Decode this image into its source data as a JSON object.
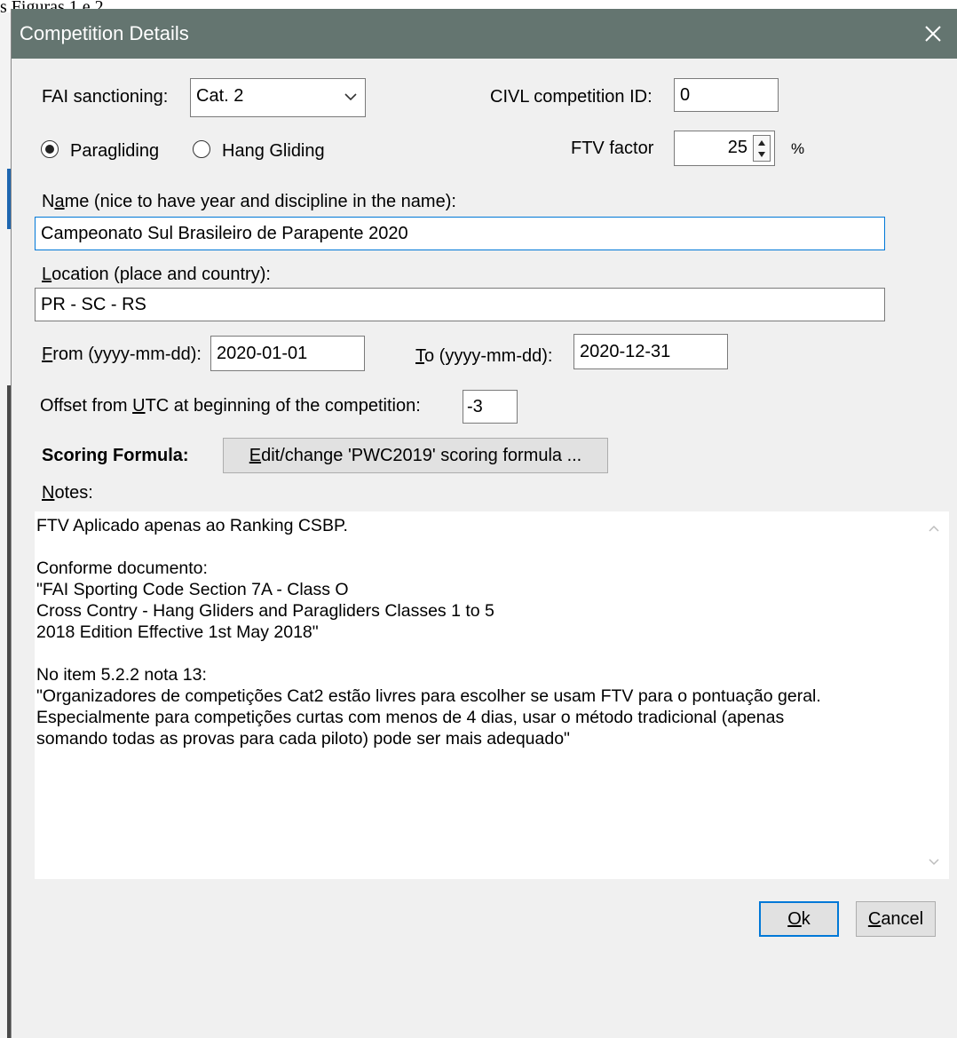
{
  "background": {
    "doc_text": "s Figuras 1 e 2."
  },
  "window": {
    "title": "Competition Details",
    "titlebar_color": "#647570"
  },
  "form": {
    "fai_label": "FAI sanctioning:",
    "fai_value": "Cat. 2",
    "civl_label": "CIVL competition ID:",
    "civl_value": "0",
    "radio_paragliding": "Paragliding",
    "radio_hang_gliding": "Hang Gliding",
    "discipline_selected": "Paragliding",
    "ftv_label": "FTV factor",
    "ftv_value": "25",
    "ftv_unit": "%",
    "name_label_ul": "a",
    "name_label_pre": "N",
    "name_label_post": "me (nice to have year and discipline in the name):",
    "name_value": "Campeonato Sul Brasileiro de Parapente 2020",
    "location_label_ul": "L",
    "location_label_post": "ocation (place and country):",
    "location_value": "PR - SC - RS",
    "from_label_ul": "F",
    "from_label_post": "rom (yyyy-mm-dd):",
    "from_value": "2020-01-01",
    "to_label_ul": "T",
    "to_label_post": "o (yyyy-mm-dd):",
    "to_value": "2020-12-31",
    "offset_label_pre": "Offset from ",
    "offset_label_ul": "U",
    "offset_label_post": "TC at beginning of the competition:",
    "offset_value": "-3",
    "scoring_label": "Scoring Formula:",
    "scoring_button_ul": "E",
    "scoring_button_post": "dit/change 'PWC2019' scoring formula ...",
    "notes_label_ul": "N",
    "notes_label_post": "otes:",
    "notes_value": "FTV Aplicado apenas ao Ranking CSBP.\n\nConforme documento:\n\"FAI Sporting Code Section 7A - Class O\nCross Contry - Hang Gliders and Paragliders Classes 1 to 5\n2018 Edition Effective 1st May 2018\"\n\nNo item 5.2.2 nota 13:\n\"Organizadores de competições Cat2 estão livres para escolher se usam FTV para o pontuação geral.\nEspecialmente para competições curtas com menos de 4 dias, usar o método tradicional (apenas\nsomando todas as provas para cada piloto) pode ser mais adequado\""
  },
  "buttons": {
    "ok_ul": "O",
    "ok_post": "k",
    "cancel_ul": "C",
    "cancel_post": "ancel"
  }
}
